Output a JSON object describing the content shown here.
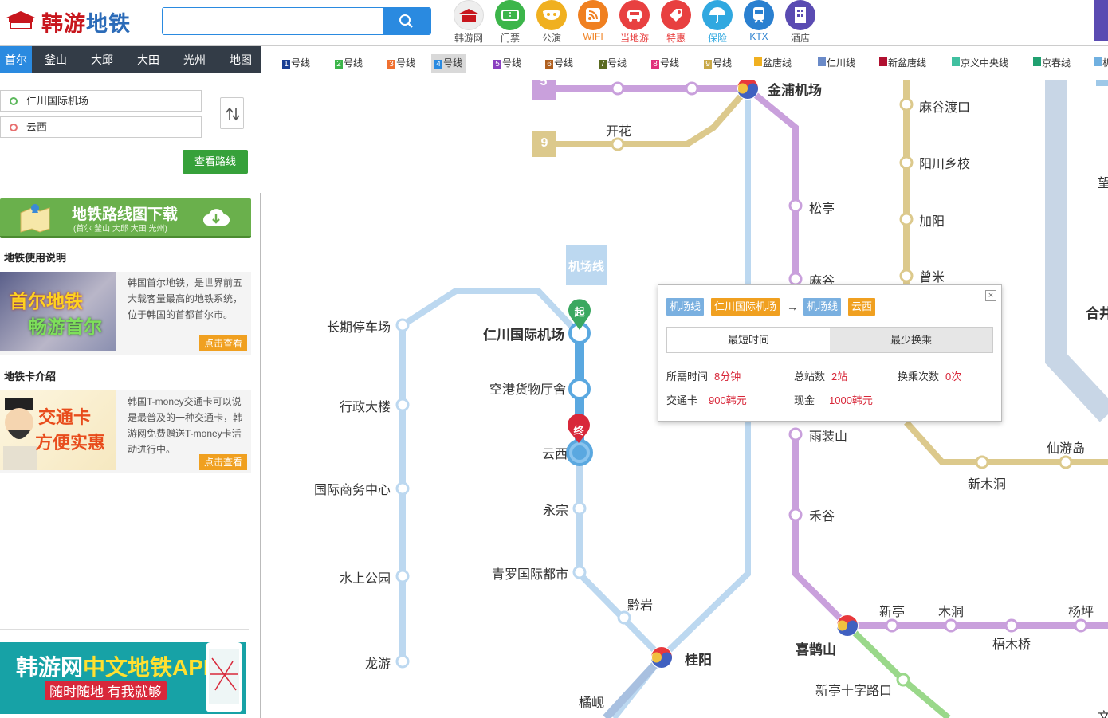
{
  "header": {
    "logo_text_red": "韩游",
    "logo_text_blue": "地铁",
    "search_value": "",
    "nav": [
      {
        "label": "韩游网",
        "icon": "hanyou-logo-icon",
        "color": "#e8e8e8"
      },
      {
        "label": "门票",
        "icon": "ticket-icon",
        "color": "#3cb54a"
      },
      {
        "label": "公演",
        "icon": "mask-icon",
        "color": "#f0b020"
      },
      {
        "label": "WIFI",
        "icon": "wifi-icon",
        "color": "#f08020"
      },
      {
        "label": "当地游",
        "icon": "car-icon",
        "color": "#e84040"
      },
      {
        "label": "特惠",
        "icon": "tag-icon",
        "color": "#e84040"
      },
      {
        "label": "保险",
        "icon": "umbrella-icon",
        "color": "#30a8e0"
      },
      {
        "label": "KTX",
        "icon": "train-icon",
        "color": "#2a80d0"
      },
      {
        "label": "酒店",
        "icon": "hotel-icon",
        "color": "#5a4bb2"
      }
    ]
  },
  "sidebar": {
    "cities": [
      "首尔",
      "釜山",
      "大邱",
      "大田",
      "光州",
      "地图"
    ],
    "active_city": "首尔",
    "from_station": "仁川国际机场",
    "to_station": "云西",
    "query_button": "查看路线",
    "download_banner": {
      "title": "地铁路线图下载",
      "sub": "(首尔 釜山 大邱 大田 光州)"
    },
    "section1": {
      "heading": "地铁使用说明",
      "img_line1": "首尔地铁",
      "img_line2": "畅游首尔",
      "text": "韩国首尔地铁，是世界前五大载客量最高的地铁系统，位于韩国的首都首尔市。",
      "more": "点击查看"
    },
    "section2": {
      "heading": "地铁卡介绍",
      "img_line1": "交通卡",
      "img_line2": "方便实惠",
      "text": "韩国T-money交通卡可以说是最普及的一种交通卡，韩游网免费赠送T-money卡活动进行中。",
      "more": "点击查看"
    },
    "app_banner": {
      "title_a": "韩游网",
      "title_b": "中文地铁APP",
      "sub": "随时随地 有我就够"
    }
  },
  "lines": [
    {
      "num": "1",
      "label": "号线",
      "color": "#1a3f94"
    },
    {
      "num": "2",
      "label": "号线",
      "color": "#3cb54a"
    },
    {
      "num": "3",
      "label": "号线",
      "color": "#f07030"
    },
    {
      "num": "4",
      "label": "号线",
      "color": "#2a8ae0",
      "active": true
    },
    {
      "num": "5",
      "label": "号线",
      "color": "#8a3fc0"
    },
    {
      "num": "6",
      "label": "号线",
      "color": "#b06020"
    },
    {
      "num": "7",
      "label": "号线",
      "color": "#5a6a20"
    },
    {
      "num": "8",
      "label": "号线",
      "color": "#e0307a"
    },
    {
      "num": "9",
      "label": "号线",
      "color": "#c8a848"
    },
    {
      "num": "",
      "label": "盆唐线",
      "color": "#f0b020"
    },
    {
      "num": "",
      "label": "仁川线",
      "color": "#6a8ac8"
    },
    {
      "num": "",
      "label": "新盆唐线",
      "color": "#b01030"
    },
    {
      "num": "",
      "label": "京义中央线",
      "color": "#40c0a0"
    },
    {
      "num": "",
      "label": "京春线",
      "color": "#20a070"
    },
    {
      "num": "",
      "label": "机",
      "color": "#70b0e0"
    }
  ],
  "map": {
    "line5_badge": "5",
    "line9_badge": "9",
    "airport_line_label": "机场线",
    "start_marker": "起",
    "end_marker": "终",
    "stations": {
      "gimpo": "金浦机场",
      "kaihua": "开花",
      "magok_ferry": "麻谷渡口",
      "yangcheon": "阳川乡校",
      "gayang": "加阳",
      "jeungmi": "曾米",
      "songjeong": "松亭",
      "magok": "麻谷",
      "incheon_airport": "仁川国际机场",
      "cargo": "空港货物厅舍",
      "unseo": "云西",
      "yeongjong": "永宗",
      "cheongna": "青罗国际都市",
      "geomam": "黔岩",
      "gyeyang": "桂阳",
      "gyulhyeon": "橘岘",
      "long_parking": "长期停车场",
      "admin": "行政大楼",
      "intl_business": "国际商务中心",
      "water_park": "水上公园",
      "longyou": "龙游",
      "hwagok": "禾谷",
      "ujangsan": "雨装山",
      "kkachisan": "喜鹊山",
      "sinjeong": "新亭",
      "mokdong": "木洞",
      "omokgyo": "梧木桥",
      "yangpyeong": "杨坪",
      "sinjeong_crossroad": "新亭十字路口",
      "sinmokdong": "新木洞",
      "seonyudo": "仙游岛",
      "partial_wang": "望",
      "partial_he": "合井",
      "partial_wen": "文"
    }
  },
  "popup": {
    "from_line": "机场线",
    "from_station": "仁川国际机场",
    "arrow": "→",
    "to_line": "机场线",
    "to_station": "云西",
    "close": "×",
    "tab_shortest": "最短时间",
    "tab_least_transfer": "最少换乘",
    "time_label": "所需时间",
    "time_value": "8分钟",
    "stops_label": "总站数",
    "stops_value": "2站",
    "transfer_label": "换乘次数",
    "transfer_value": "0次",
    "card_label": "交通卡",
    "card_value": "900韩元",
    "cash_label": "现金",
    "cash_value": "1000韩元"
  }
}
